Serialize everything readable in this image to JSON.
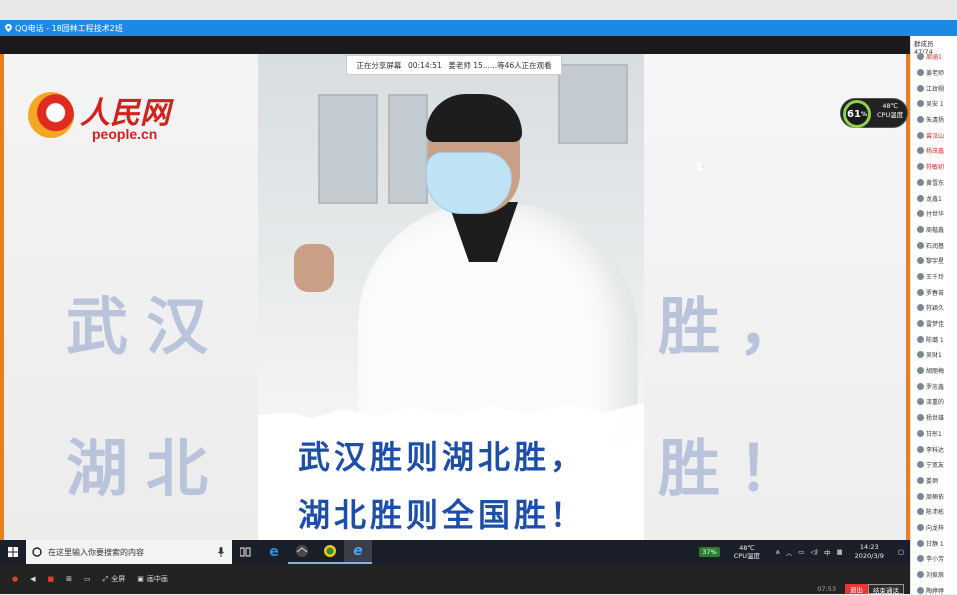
{
  "window": {
    "title": "QQ电话 - 18园林工程技术2班"
  },
  "share_bar": {
    "status": "正在分享屏幕",
    "time": "00:14:51",
    "viewers": "姜老师 15......等46人正在观看"
  },
  "logo": {
    "text": "人民网",
    "sub": "people.cn"
  },
  "banner": {
    "line1": "武汉胜则湖北胜，",
    "line2": "湖北胜则全国胜！"
  },
  "bg_text": {
    "left_row1": "武汉",
    "left_row2": "湖北",
    "right_row1": "胜，",
    "right_row2": "胜！"
  },
  "cpu": {
    "percent": "61",
    "percent_unit": "%",
    "temp": "48℃",
    "label": "CPU温度"
  },
  "taskbar": {
    "search_placeholder": "在这里输入你要搜索的内容",
    "battery": "37%",
    "tray_temp": "48℃",
    "tray_temp_label": "CPU温度",
    "time": "14:23",
    "date": "2020/3/9",
    "ime": "中"
  },
  "bottombar": {
    "fullscreen": "全屏",
    "mute": "画中画",
    "network": "07:53",
    "exit": "退出",
    "end": "结束通话"
  },
  "members": {
    "title": "群成员 47/74",
    "items": [
      {
        "name": "周涵1",
        "red": true
      },
      {
        "name": "姜老师",
        "red": false
      },
      {
        "name": "江玟栩",
        "red": false
      },
      {
        "name": "吴安 1",
        "red": false
      },
      {
        "name": "朱清扬",
        "red": false
      },
      {
        "name": "曾汉山",
        "red": true
      },
      {
        "name": "杨茂鑫",
        "red": true
      },
      {
        "name": "符敏初",
        "red": true
      },
      {
        "name": "黄雪东",
        "red": false
      },
      {
        "name": "龙鑫1",
        "red": false
      },
      {
        "name": "付世华",
        "red": false
      },
      {
        "name": "周楷鑫",
        "red": false
      },
      {
        "name": "石润基",
        "red": false
      },
      {
        "name": "黎宇星",
        "red": false
      },
      {
        "name": "王千玲",
        "red": false
      },
      {
        "name": "罗春苔",
        "red": false
      },
      {
        "name": "符颖久",
        "red": false
      },
      {
        "name": "雷梦佳",
        "red": false
      },
      {
        "name": "陈璐 1",
        "red": false
      },
      {
        "name": "吴财1",
        "red": false
      },
      {
        "name": "胡丽梅",
        "red": false
      },
      {
        "name": "罗忠鑫",
        "red": false
      },
      {
        "name": "泽重的",
        "red": false
      },
      {
        "name": "杨世雄",
        "red": false
      },
      {
        "name": "甘彤1",
        "red": false
      },
      {
        "name": "李科达",
        "red": false
      },
      {
        "name": "宁宽友",
        "red": false
      },
      {
        "name": "娄炳",
        "red": false
      },
      {
        "name": "周楠依",
        "red": false
      },
      {
        "name": "陈沛栋",
        "red": false
      },
      {
        "name": "向龙梓",
        "red": false
      },
      {
        "name": "甘静 1",
        "red": false
      },
      {
        "name": "李小芳",
        "red": false
      },
      {
        "name": "刘俊辰",
        "red": false
      },
      {
        "name": "陶婷婷",
        "red": false
      }
    ]
  }
}
